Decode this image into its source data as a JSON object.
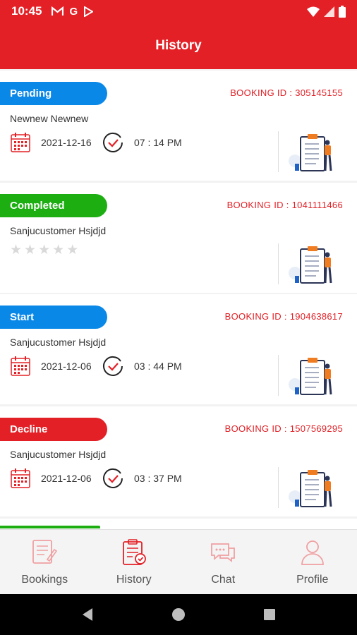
{
  "status_bar": {
    "time": "10:45",
    "icons": [
      "gmail-icon",
      "google-icon",
      "play-store-icon"
    ],
    "right_icons": [
      "wifi-icon",
      "signal-icon",
      "battery-icon"
    ]
  },
  "header": {
    "title": "History"
  },
  "colors": {
    "brand_red": "#e32026",
    "pending_blue": "#0a88e8",
    "completed_green": "#1daf12",
    "decline_red": "#e32026"
  },
  "bookings": [
    {
      "status": "Pending",
      "booking_id": "BOOKING ID : 305145155",
      "customer": "Newnew Newnew",
      "date": "2021-12-16",
      "time": "07 : 14 PM"
    },
    {
      "status": "Completed",
      "booking_id": "BOOKING ID : 1041111466",
      "customer": "Sanjucustomer Hsjdjd",
      "rating": 0,
      "rating_max": 5
    },
    {
      "status": "Start",
      "booking_id": "BOOKING ID : 1904638617",
      "customer": "Sanjucustomer Hsjdjd",
      "date": "2021-12-06",
      "time": "03 : 44 PM"
    },
    {
      "status": "Decline",
      "booking_id": "BOOKING ID : 1507569295",
      "customer": "Sanjucustomer Hsjdjd",
      "date": "2021-12-06",
      "time": "03 : 37 PM"
    }
  ],
  "bottom_nav": {
    "items": [
      {
        "label": "Bookings",
        "icon": "bookings-icon",
        "active": false
      },
      {
        "label": "History",
        "icon": "history-icon",
        "active": true
      },
      {
        "label": "Chat",
        "icon": "chat-icon",
        "active": false
      },
      {
        "label": "Profile",
        "icon": "profile-icon",
        "active": false
      }
    ]
  },
  "system_nav": [
    "back-icon",
    "home-icon",
    "recents-icon"
  ]
}
